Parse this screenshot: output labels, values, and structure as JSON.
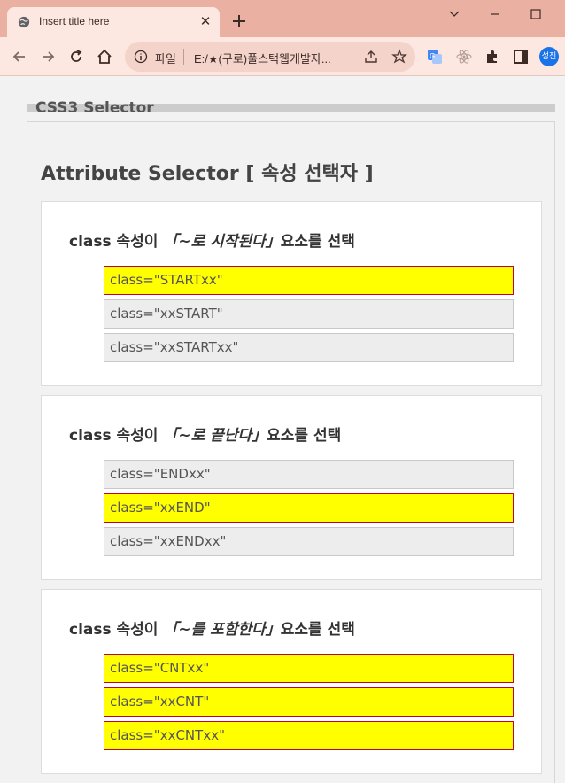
{
  "browser": {
    "tab_title": "Insert title here",
    "scheme_label": "파일",
    "url": "E:/★(구로)풀스택웹개발자...",
    "profile_label": "성진",
    "colors": {
      "frame": "#eab1a2",
      "toolbar": "#fde8e1",
      "omnibox": "#f4d3ca"
    }
  },
  "page": {
    "header": "CSS3 Selector",
    "section_title": "Attribute Selector [ 속성 선택자 ]",
    "groups": [
      {
        "title_prefix": "class 속성이",
        "title_highlight": "「~로 시작된다」",
        "title_suffix": "요소를 선택",
        "items": [
          {
            "label": "class=\"STARTxx\"",
            "selected": true
          },
          {
            "label": "class=\"xxSTART\"",
            "selected": false
          },
          {
            "label": "class=\"xxSTARTxx\"",
            "selected": false
          }
        ]
      },
      {
        "title_prefix": "class 속성이",
        "title_highlight": "「~로 끝난다」",
        "title_suffix": "요소를 선택",
        "items": [
          {
            "label": "class=\"ENDxx\"",
            "selected": false
          },
          {
            "label": "class=\"xxEND\"",
            "selected": true
          },
          {
            "label": "class=\"xxENDxx\"",
            "selected": false
          }
        ]
      },
      {
        "title_prefix": "class 속성이",
        "title_highlight": "「~를 포함한다」",
        "title_suffix": "요소를 선택",
        "items": [
          {
            "label": "class=\"CNTxx\"",
            "selected": true
          },
          {
            "label": "class=\"xxCNT\"",
            "selected": true
          },
          {
            "label": "class=\"xxCNTxx\"",
            "selected": true
          }
        ]
      }
    ],
    "colors": {
      "selected_bg": "#ffff00",
      "selected_border": "#c0003a",
      "unselected_bg": "#ededed"
    }
  }
}
